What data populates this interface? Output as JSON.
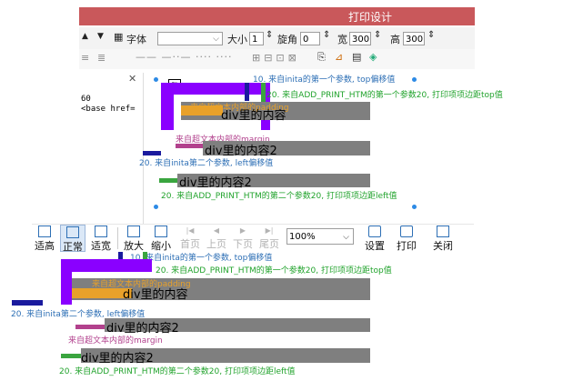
{
  "app_title": "打印设计",
  "toolbar1": {
    "font_label": "字体",
    "size_label": "大小",
    "size_value": "1",
    "rotate_label": "旋角",
    "rotate_value": "0",
    "width_label": "宽",
    "width_value": "300",
    "height_label": "高",
    "height_value": "300"
  },
  "left_code": {
    "line1": "60",
    "line2": "<base href="
  },
  "designer_labels": {
    "top_offset": "10. 来自inita的第一个参数, top偏移值",
    "add_print_top": "20. 来自ADD_PRINT_HTM的第一个参数20, 打印项项边距top值",
    "padding": "来自超文本内部的padding",
    "div1": "div里的内容",
    "margin": "来自超文本内部的margin",
    "div2": "div里的内容2",
    "left_offset": "20. 来自inita第二个参数, left偏移值",
    "div3": "div里的内容2",
    "add_print_left": "20. 来自ADD_PRINT_HTM的第二个参数20, 打印项项边距left值"
  },
  "preview_toolbar": {
    "fit_height": "适高",
    "normal": "正常",
    "fit_width": "适宽",
    "zoom_in": "放大",
    "zoom_out": "缩小",
    "first_page": "首页",
    "prev_page": "上页",
    "next_page": "下页",
    "last_page": "尾页",
    "zoom_value": "100%",
    "settings": "设置",
    "print": "打印",
    "close": "关闭"
  },
  "preview_labels": {
    "top_offset": "10. 来自inita的第一个参数, top偏移值",
    "add_print_top": "20. 来自ADD_PRINT_HTM的第一个参数20, 打印项项边距top值",
    "padding": "来自超文本内部的padding",
    "div1": "div里的内容",
    "left_offset": "20. 来自inita第二个参数, left偏移值",
    "div2": "div里的内容2",
    "margin": "来自超文本内部的margin",
    "div3": "div里的内容2",
    "add_print_left": "20. 来自ADD_PRINT_HTM的第二个参数20, 打印项项边距left值"
  },
  "colors": {
    "title_bar": "#c9585b",
    "purple": "#8a00ff",
    "navy": "#1a1a9e",
    "green": "#3aa53f",
    "magenta": "#b2418d",
    "orange": "#e8a12a",
    "gray_block": "#7f7f7f",
    "label_blue": "#2d6fb5",
    "label_green": "#21a32c"
  }
}
